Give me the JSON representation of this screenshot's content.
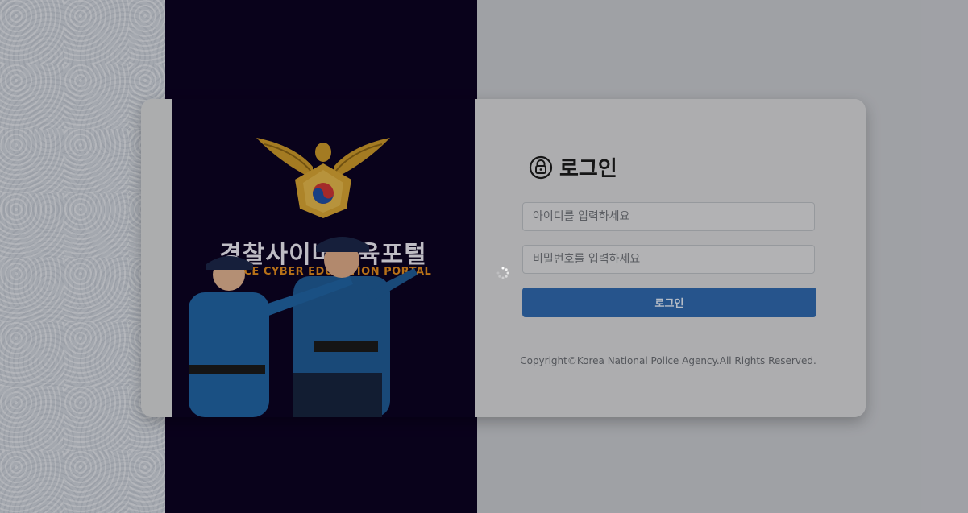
{
  "portal": {
    "title_ko": "경찰사이버교육포털",
    "title_en": "POLICE CYBER EDUCATION PORTAL"
  },
  "login": {
    "heading": "로그인",
    "id_placeholder": "아이디를 입력하세요",
    "pw_placeholder": "비밀번호를 입력하세요",
    "submit_label": "로그인",
    "lock_icon": "lock-circle-icon"
  },
  "footer": {
    "copyright": "Copyright©Korea National Police Agency.All Rights Reserved."
  },
  "colors": {
    "accent": "#2f67ab",
    "navy": "#0c0322",
    "subtitle": "#e08a1e"
  }
}
